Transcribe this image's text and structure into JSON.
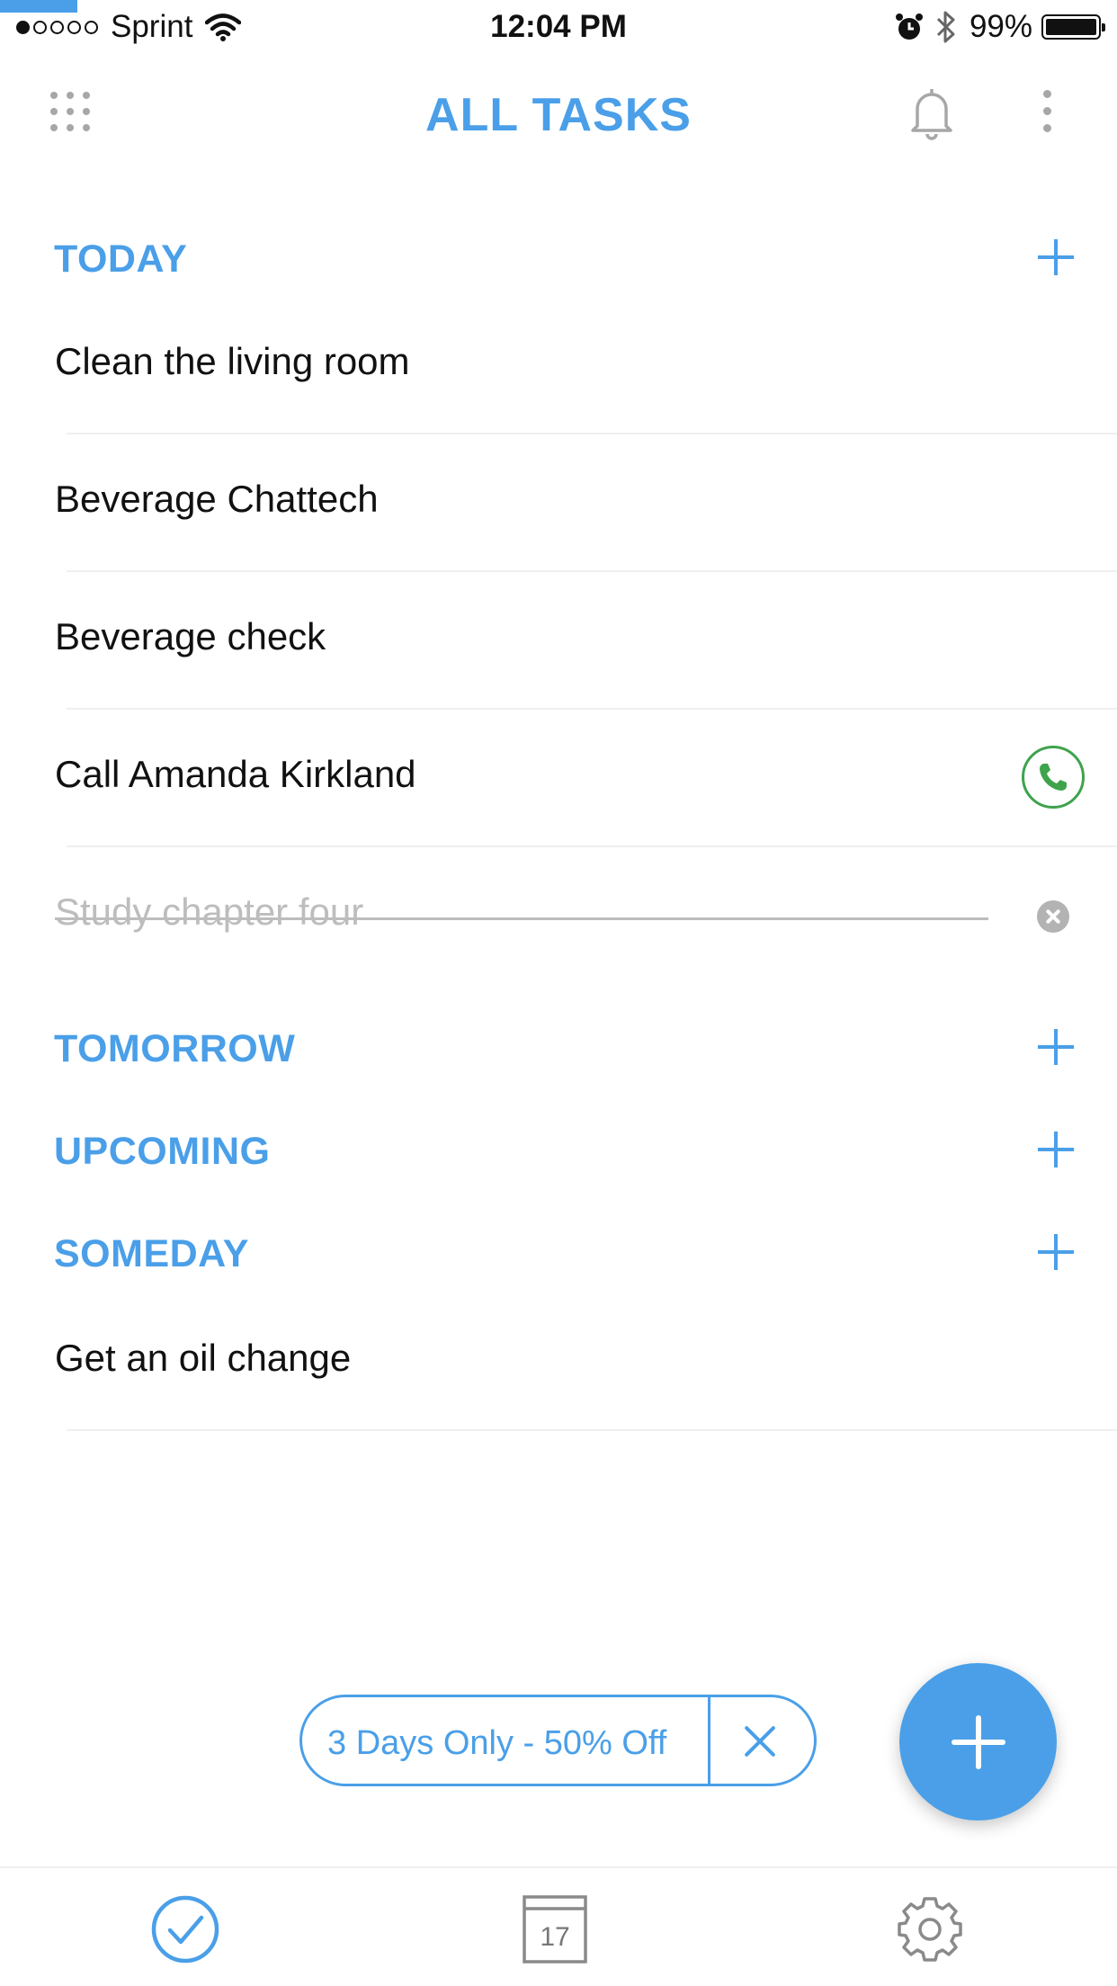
{
  "colors": {
    "accent": "#4a9fe8",
    "call": "#3fa34d",
    "muted": "#bdbdbd"
  },
  "status_bar": {
    "carrier": "Sprint",
    "time": "12:04 PM",
    "battery": "99%",
    "signal_bars_filled": 1,
    "signal_bars_total": 5
  },
  "header": {
    "title": "ALL TASKS",
    "icons": [
      "grid-icon",
      "bell-icon",
      "more-vertical-icon"
    ]
  },
  "sections": [
    {
      "title": "TODAY",
      "tasks": [
        {
          "label": "Clean the living room"
        },
        {
          "label": "Beverage Chattech"
        },
        {
          "label": "Beverage check"
        },
        {
          "label": "Call Amanda Kirkland",
          "action_icon": "phone-icon"
        },
        {
          "label": "Study chapter four",
          "completed": true,
          "action_icon": "clear-icon"
        }
      ]
    },
    {
      "title": "TOMORROW",
      "tasks": []
    },
    {
      "title": "UPCOMING",
      "tasks": []
    },
    {
      "title": "SOMEDAY",
      "tasks": [
        {
          "label": "Get an oil change"
        }
      ]
    }
  ],
  "promo": {
    "label": "3 Days Only - 50% Off"
  },
  "tabbar": {
    "calendar_day": "17",
    "icons": [
      "check-circle-icon",
      "calendar-icon",
      "gear-icon"
    ]
  }
}
